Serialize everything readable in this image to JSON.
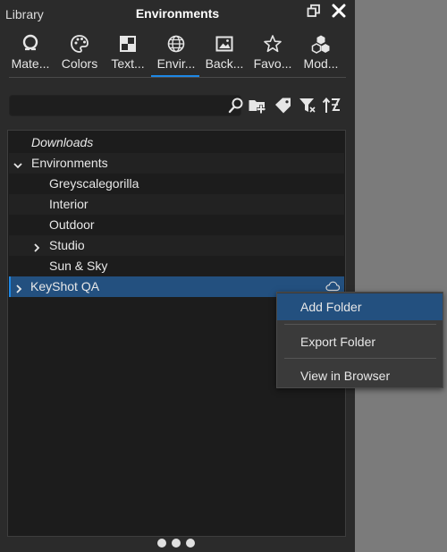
{
  "header": {
    "library_label": "Library",
    "title": "Environments"
  },
  "tabs": [
    {
      "label": "Mate...",
      "icon": "material-icon",
      "active": false
    },
    {
      "label": "Colors",
      "icon": "colors-palette-icon",
      "active": false
    },
    {
      "label": "Text...",
      "icon": "textures-icon",
      "active": false
    },
    {
      "label": "Envir...",
      "icon": "environments-globe-icon",
      "active": true
    },
    {
      "label": "Back...",
      "icon": "backplates-image-icon",
      "active": false
    },
    {
      "label": "Favo...",
      "icon": "favorites-star-icon",
      "active": false
    },
    {
      "label": "Mod...",
      "icon": "models-cubes-icon",
      "active": false
    }
  ],
  "search": {
    "value": "",
    "placeholder": ""
  },
  "tree": {
    "items": [
      {
        "label": "Downloads",
        "italic": true
      },
      {
        "label": "Environments",
        "expanded": true
      },
      {
        "label": "Greyscalegorilla"
      },
      {
        "label": "Interior"
      },
      {
        "label": "Outdoor"
      },
      {
        "label": "Studio",
        "expanded": false
      },
      {
        "label": "Sun & Sky"
      },
      {
        "label": "KeyShot QA",
        "selected": true,
        "cloud": true
      }
    ]
  },
  "context_menu": {
    "items": [
      {
        "label": "Add Folder",
        "highlighted": true
      },
      {
        "label": "Export Folder"
      },
      {
        "label": "View in Browser"
      }
    ]
  },
  "colors": {
    "accent": "#1e88e5",
    "selection": "#23507f",
    "panel": "#2b2b2b",
    "tree_bg": "#1c1c1c",
    "desktop": "#7b7b7b"
  }
}
